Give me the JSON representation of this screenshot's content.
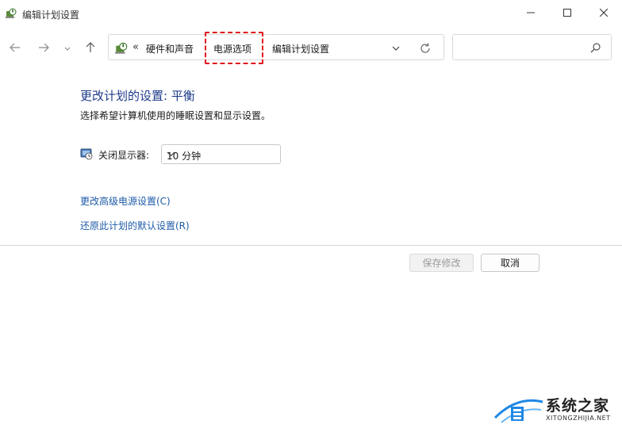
{
  "window": {
    "title": "编辑计划设置",
    "minimize_icon": "minimize-icon",
    "maximize_icon": "maximize-icon",
    "close_icon": "close-icon"
  },
  "nav": {
    "back_icon": "arrow-left-icon",
    "forward_icon": "arrow-right-icon",
    "recent_icon": "chevron-down-icon",
    "up_icon": "arrow-up-icon"
  },
  "address": {
    "overflow": "«",
    "crumbs": [
      "硬件和声音",
      "电源选项",
      "编辑计划设置"
    ],
    "highlighted_crumb": "电源选项",
    "highlight_color": "#e0151b"
  },
  "search": {
    "placeholder": ""
  },
  "content": {
    "heading": "更改计划的设置: 平衡",
    "description": "选择希望计算机使用的睡眠设置和显示设置。",
    "display_off_label": "关闭显示器:",
    "display_off_value": "10 分钟",
    "link_advanced": "更改高级电源设置(C)",
    "link_restore": "还原此计划的默认设置(R)"
  },
  "buttons": {
    "save": "保存修改",
    "cancel": "取消"
  },
  "watermark": {
    "name": "系统之家",
    "url": "XITONGZHIJIA.NET",
    "accent": "#1e88e5"
  },
  "colors": {
    "heading": "#1e3a8a",
    "link": "#1e5ba8"
  }
}
